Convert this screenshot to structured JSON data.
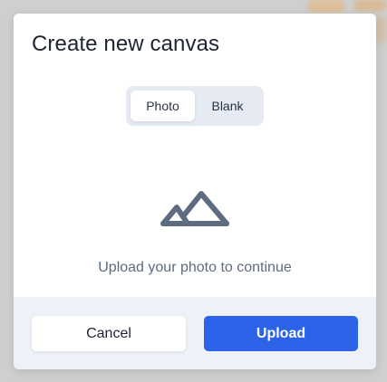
{
  "dialog": {
    "title": "Create new canvas",
    "tabs": [
      {
        "label": "Photo",
        "selected": true
      },
      {
        "label": "Blank",
        "selected": false
      }
    ],
    "icon": "mountains-icon",
    "hint": "Upload your photo to continue"
  },
  "footer": {
    "cancel_label": "Cancel",
    "upload_label": "Upload"
  },
  "colors": {
    "primary": "#2c63e8",
    "icon": "#5f6b80",
    "footer_bg": "#eef2f8",
    "segmented_bg": "#e6eaf3"
  }
}
